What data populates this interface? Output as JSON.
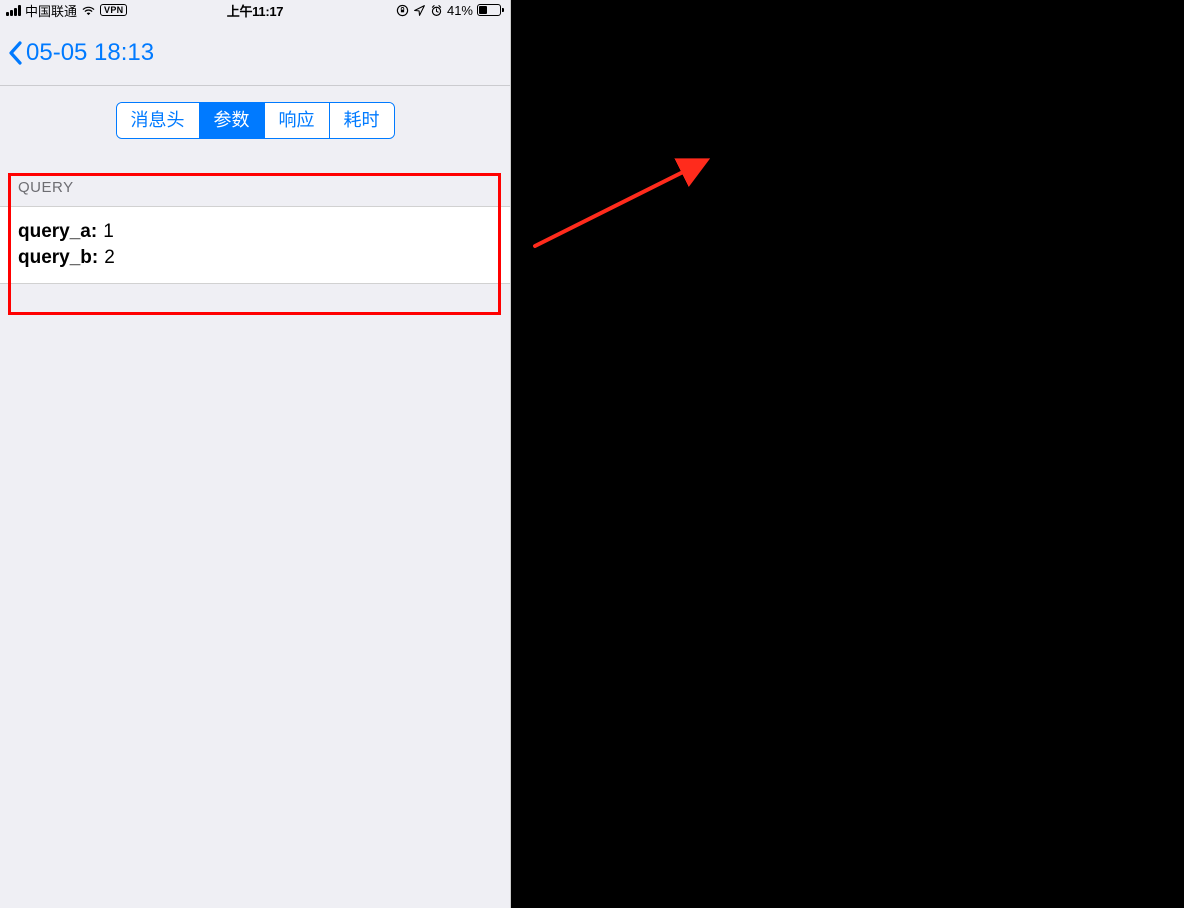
{
  "status_bar": {
    "carrier": "中国联通",
    "vpn_label": "VPN",
    "time": "上午11:17",
    "battery_text": "41%"
  },
  "nav": {
    "back_title": "05-05 18:13"
  },
  "tabs": {
    "headers": "消息头",
    "params": "参数",
    "response": "响应",
    "timing": "耗时",
    "active_index": 1
  },
  "section": {
    "title": "QUERY",
    "params": [
      {
        "key": "query_a:",
        "val": "1"
      },
      {
        "key": "query_b:",
        "val": "2"
      }
    ]
  },
  "annotation": {
    "highlight_color": "#ff0000",
    "arrow_color": "#ff2b1c"
  }
}
